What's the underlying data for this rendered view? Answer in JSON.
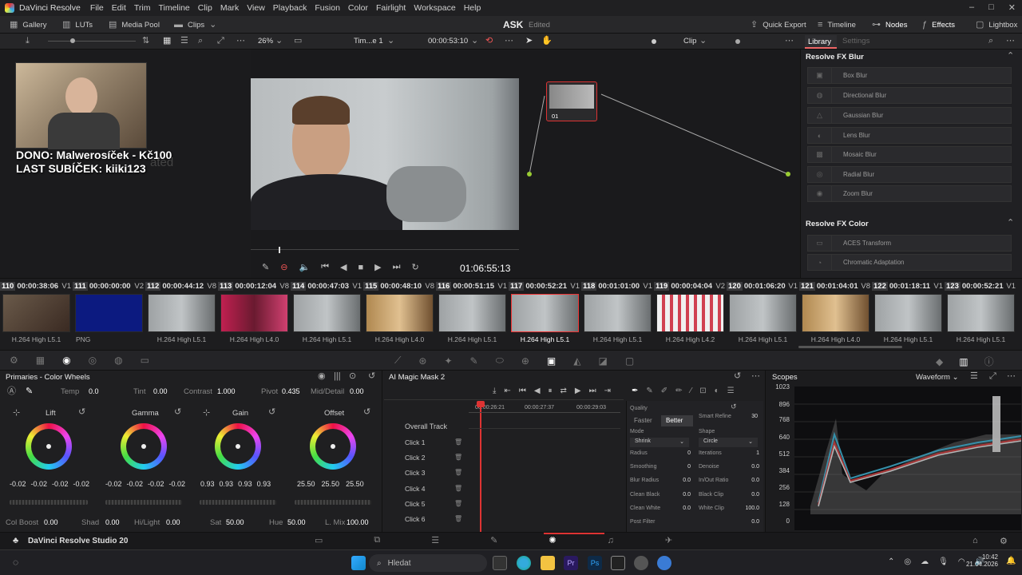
{
  "app": {
    "name": "DaVinci Resolve",
    "project": "ASK",
    "status": "Edited",
    "footer_name": "DaVinci Resolve Studio 20"
  },
  "menu": [
    "File",
    "Edit",
    "Trim",
    "Timeline",
    "Clip",
    "Mark",
    "View",
    "Playback",
    "Fusion",
    "Color",
    "Fairlight",
    "Workspace",
    "Help"
  ],
  "toolbar": {
    "gallery": "Gallery",
    "luts": "LUTs",
    "media_pool": "Media Pool",
    "clips": "Clips",
    "quick_export": "Quick Export",
    "timeline": "Timeline",
    "nodes": "Nodes",
    "effects": "Effects",
    "lightbox": "Lightbox"
  },
  "viewer": {
    "zoom": "26%",
    "timeline_name": "Tim...e 1",
    "timecode": "00:00:53:10",
    "clip_mode": "Clip",
    "playhead_tc": "01:06:55:13"
  },
  "overlay": {
    "line1": "DONO: Malwerosíček - Kč100",
    "line2": "LAST SUBÍČEK: kiiki123",
    "ghost": "ated"
  },
  "node": {
    "label": "01"
  },
  "library": {
    "tab_library": "Library",
    "tab_settings": "Settings",
    "section_blur": "Resolve FX Blur",
    "blur_items": [
      "Box Blur",
      "Directional Blur",
      "Gaussian Blur",
      "Lens Blur",
      "Mosaic Blur",
      "Radial Blur",
      "Zoom Blur"
    ],
    "section_color": "Resolve FX Color",
    "color_items": [
      "ACES Transform",
      "Chromatic Adaptation"
    ]
  },
  "clips": [
    {
      "num": "110",
      "tc": "00:00:38:06",
      "track": "V1",
      "codec": "H.264 High L5.1"
    },
    {
      "num": "111",
      "tc": "00:00:00:00",
      "track": "V2",
      "codec": "PNG"
    },
    {
      "num": "112",
      "tc": "00:00:44:12",
      "track": "V8",
      "codec": "H.264 High L5.1"
    },
    {
      "num": "113",
      "tc": "00:00:12:04",
      "track": "V8",
      "codec": "H.264 High L4.0"
    },
    {
      "num": "114",
      "tc": "00:00:47:03",
      "track": "V1",
      "codec": "H.264 High L5.1"
    },
    {
      "num": "115",
      "tc": "00:00:48:10",
      "track": "V8",
      "codec": "H.264 High L4.0"
    },
    {
      "num": "116",
      "tc": "00:00:51:15",
      "track": "V1",
      "codec": "H.264 High L5.1"
    },
    {
      "num": "117",
      "tc": "00:00:52:21",
      "track": "V1",
      "codec": "H.264 High L5.1"
    },
    {
      "num": "118",
      "tc": "00:01:01:00",
      "track": "V1",
      "codec": "H.264 High L5.1"
    },
    {
      "num": "119",
      "tc": "00:00:04:04",
      "track": "V2",
      "codec": "H.264 High L4.2"
    },
    {
      "num": "120",
      "tc": "00:01:06:20",
      "track": "V1",
      "codec": "H.264 High L5.1"
    },
    {
      "num": "121",
      "tc": "00:01:04:01",
      "track": "V8",
      "codec": "H.264 High L4.0"
    },
    {
      "num": "122",
      "tc": "00:01:18:11",
      "track": "V1",
      "codec": "H.264 High L5.1"
    },
    {
      "num": "123",
      "tc": "00:00:52:21",
      "track": "V1",
      "codec": "H.264 High L5.1"
    }
  ],
  "primaries": {
    "title": "Primaries - Color Wheels",
    "temp_label": "Temp",
    "temp": "0.0",
    "tint_label": "Tint",
    "tint": "0.00",
    "contrast_label": "Contrast",
    "contrast": "1.000",
    "pivot_label": "Pivot",
    "pivot": "0.435",
    "middetail_label": "Mid/Detail",
    "middetail": "0.00",
    "wheels": [
      {
        "name": "Lift",
        "vals": [
          "-0.02",
          "-0.02",
          "-0.02",
          "-0.02"
        ]
      },
      {
        "name": "Gamma",
        "vals": [
          "-0.02",
          "-0.02",
          "-0.02",
          "-0.02"
        ]
      },
      {
        "name": "Gain",
        "vals": [
          "0.93",
          "0.93",
          "0.93",
          "0.93"
        ]
      },
      {
        "name": "Offset",
        "vals": [
          "25.50",
          "25.50",
          "25.50"
        ]
      }
    ],
    "colboost_label": "Col Boost",
    "colboost": "0.00",
    "shad_label": "Shad",
    "shad": "0.00",
    "hilight_label": "Hi/Light",
    "hilight": "0.00",
    "sat_label": "Sat",
    "sat": "50.00",
    "hue_label": "Hue",
    "hue": "50.00",
    "lmix_label": "L. Mix",
    "lmix": "100.00"
  },
  "magicmask": {
    "title": "AI Magic Mask 2",
    "ruler": [
      "00:00:26:21",
      "00:00:27:37",
      "00:00:29:03"
    ],
    "overall": "Overall Track",
    "clicks": [
      "Click 1",
      "Click 2",
      "Click 3",
      "Click 4",
      "Click 5",
      "Click 6"
    ],
    "quality_label": "Quality",
    "faster": "Faster",
    "better": "Better",
    "smart_refine_label": "Smart Refine",
    "smart_refine": "30",
    "mode_label": "Mode",
    "mode": "Shrink",
    "shape_label": "Shape",
    "shape": "Circle",
    "radius_label": "Radius",
    "radius": "0",
    "iterations_label": "Iterations",
    "iterations": "1",
    "smoothing_label": "Smoothing",
    "smoothing": "0",
    "denoise_label": "Denoise",
    "denoise": "0.0",
    "blur_radius_label": "Blur Radius",
    "blur_radius": "0.0",
    "inout_label": "In/Out Ratio",
    "inout": "0.0",
    "clean_black_label": "Clean Black",
    "clean_black": "0.0",
    "black_clip_label": "Black Clip",
    "black_clip": "0.0",
    "clean_white_label": "Clean White",
    "clean_white": "0.0",
    "white_clip_label": "White Clip",
    "white_clip": "100.0",
    "post_filter_label": "Post Filter",
    "post_filter": "0.0"
  },
  "scopes": {
    "title": "Scopes",
    "mode": "Waveform",
    "ticks": [
      "1023",
      "896",
      "768",
      "640",
      "512",
      "384",
      "256",
      "128",
      "0"
    ]
  },
  "taskbar": {
    "search": "Hledat",
    "time": "10:42",
    "date": "21.04.2026"
  }
}
